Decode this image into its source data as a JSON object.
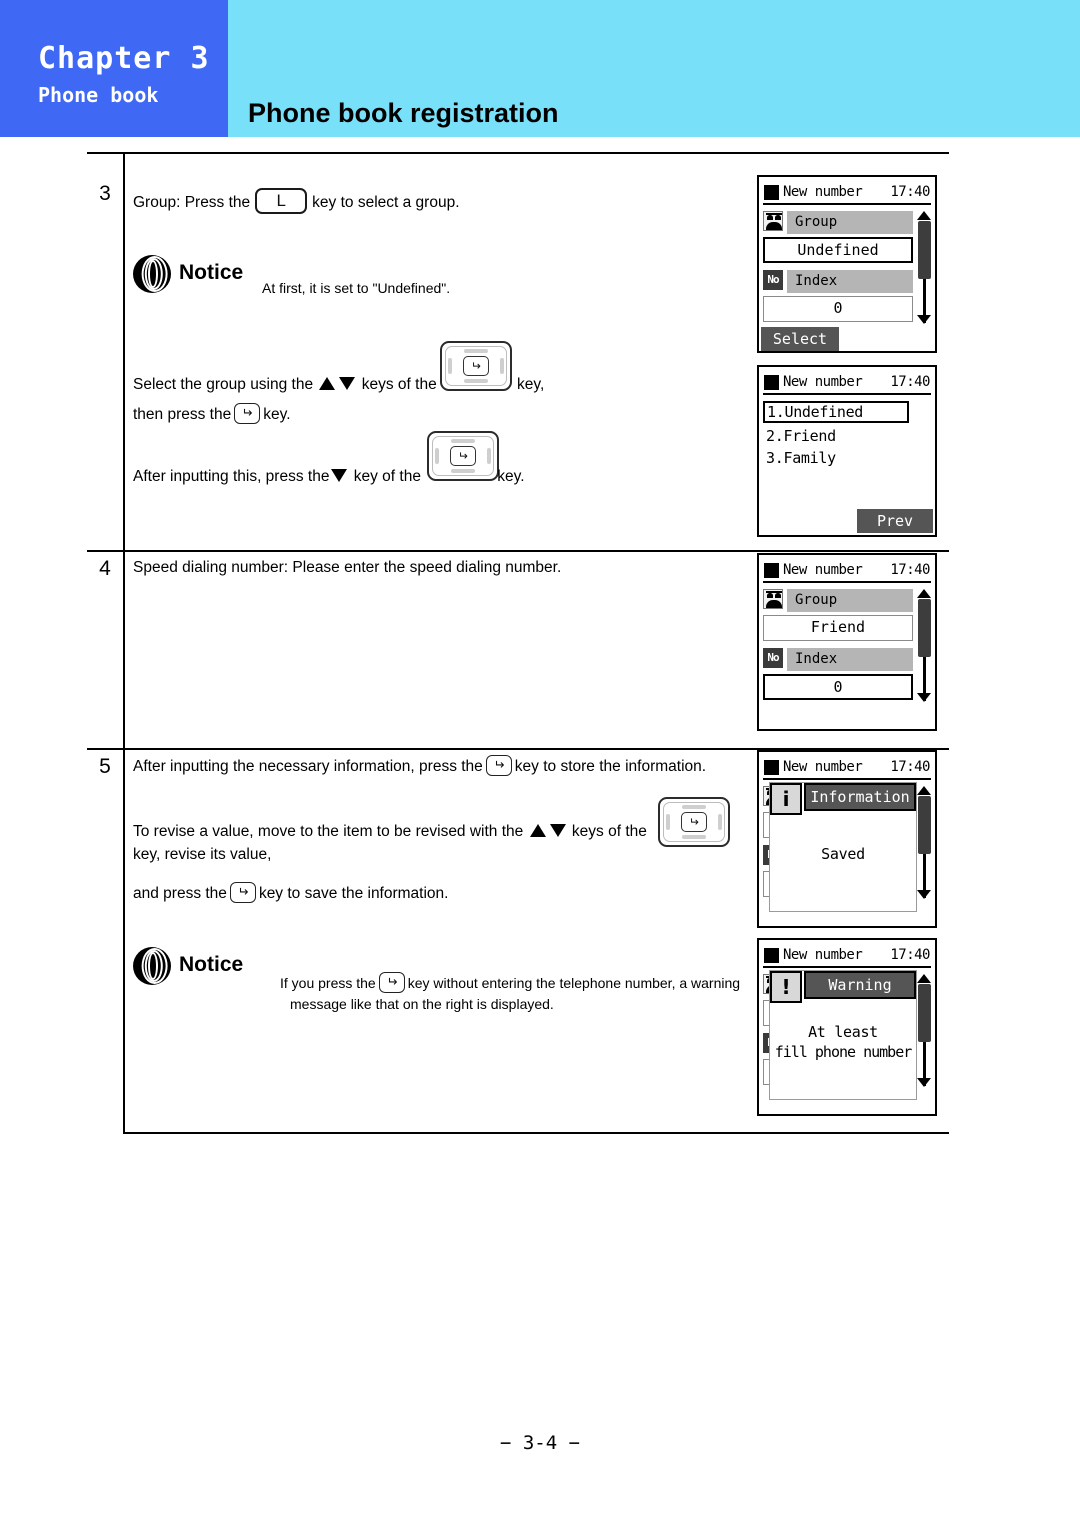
{
  "header": {
    "chapter": "Chapter 3",
    "subtitle": "Phone book",
    "title": "Phone book registration",
    "left_color": "#3f68f5",
    "band_color": "#79e0f9"
  },
  "steps": [
    {
      "number": "3",
      "line1_a": "Group: Press the",
      "line1_b": "key to select a group.",
      "notice": {
        "label": "Notice",
        "text": "At first, it is set to \"Undefined\"."
      },
      "line2_a": "Select the group using the",
      "line2_b": "keys of the",
      "line2_c": "key,",
      "line3_a": "then press the",
      "line3_b": "key.",
      "line4_a": "After inputting this, press the",
      "line4_b": "key of the",
      "line4_c": "key."
    },
    {
      "number": "4",
      "line1": "Speed dialing number:  Please enter the speed dialing number."
    },
    {
      "number": "5",
      "line1_a": "After inputting the necessary information,  press the",
      "line1_b": "key to store the information.",
      "line2_a": "To revise a value, move to the item to be revised with the",
      "line2_b": "keys of the",
      "line3": "key, revise its value,",
      "line4_a": "and press the",
      "line4_b": "key to save the information.",
      "notice": {
        "label": "Notice",
        "text_a": "If you press the",
        "text_b": "key without entering the telephone number, a warning",
        "text_c": "message like that on the right is displayed."
      }
    }
  ],
  "screens": {
    "group_undefined": {
      "title": "New number",
      "clock": "17:40",
      "rows": [
        {
          "icon": "group-icon",
          "label": "Group",
          "value": "Undefined"
        },
        {
          "icon": "no-icon",
          "label": "Index",
          "value": "0"
        }
      ],
      "softkey": "Select"
    },
    "group_list": {
      "title": "New number",
      "clock": "17:40",
      "items": [
        {
          "text": "1.Undefined",
          "selected": true
        },
        {
          "text": "2.Friend",
          "selected": false
        },
        {
          "text": "3.Family",
          "selected": false
        }
      ],
      "softkey": "Prev"
    },
    "group_friend": {
      "title": "New number",
      "clock": "17:40",
      "rows": [
        {
          "icon": "group-icon",
          "label": "Group",
          "value": "Friend"
        },
        {
          "icon": "no-icon",
          "label": "Index",
          "value": "0"
        }
      ]
    },
    "information": {
      "title": "New number",
      "clock": "17:40",
      "dialog_icon": "info-icon",
      "dialog_icon_glyph": "i",
      "dialog_title": "Information",
      "message_line1": "Saved"
    },
    "warning": {
      "title": "New number",
      "clock": "17:40",
      "dialog_icon": "warning-icon",
      "dialog_icon_glyph": "!",
      "dialog_title": "Warning",
      "message_line1": "At least",
      "message_line2": "fill phone number"
    }
  },
  "footer": {
    "page": "− 3-4 −"
  }
}
